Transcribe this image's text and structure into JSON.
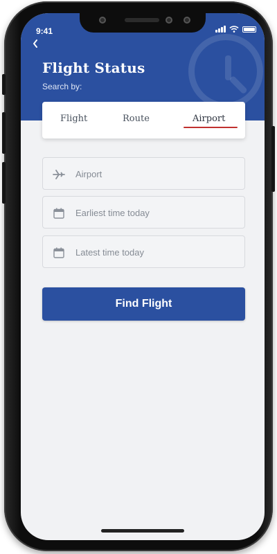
{
  "status_bar": {
    "time": "9:41"
  },
  "header": {
    "title": "Flight Status",
    "subtitle": "Search by:",
    "background_icon": "clock-icon",
    "back_icon": "chevron-left-icon"
  },
  "tabs": [
    {
      "label": "Flight",
      "selected": false
    },
    {
      "label": "Route",
      "selected": false
    },
    {
      "label": "Airport",
      "selected": true
    }
  ],
  "form": {
    "fields": [
      {
        "placeholder": "Airport",
        "icon": "airplane-icon",
        "value": ""
      },
      {
        "placeholder": "Earliest time today",
        "icon": "calendar-icon",
        "value": ""
      },
      {
        "placeholder": "Latest time today",
        "icon": "calendar-icon",
        "value": ""
      }
    ],
    "submit_label": "Find Flight"
  },
  "colors": {
    "primary": "#2b50a0",
    "tab_indicator": "#c0302e",
    "background": "#f1f2f4"
  }
}
